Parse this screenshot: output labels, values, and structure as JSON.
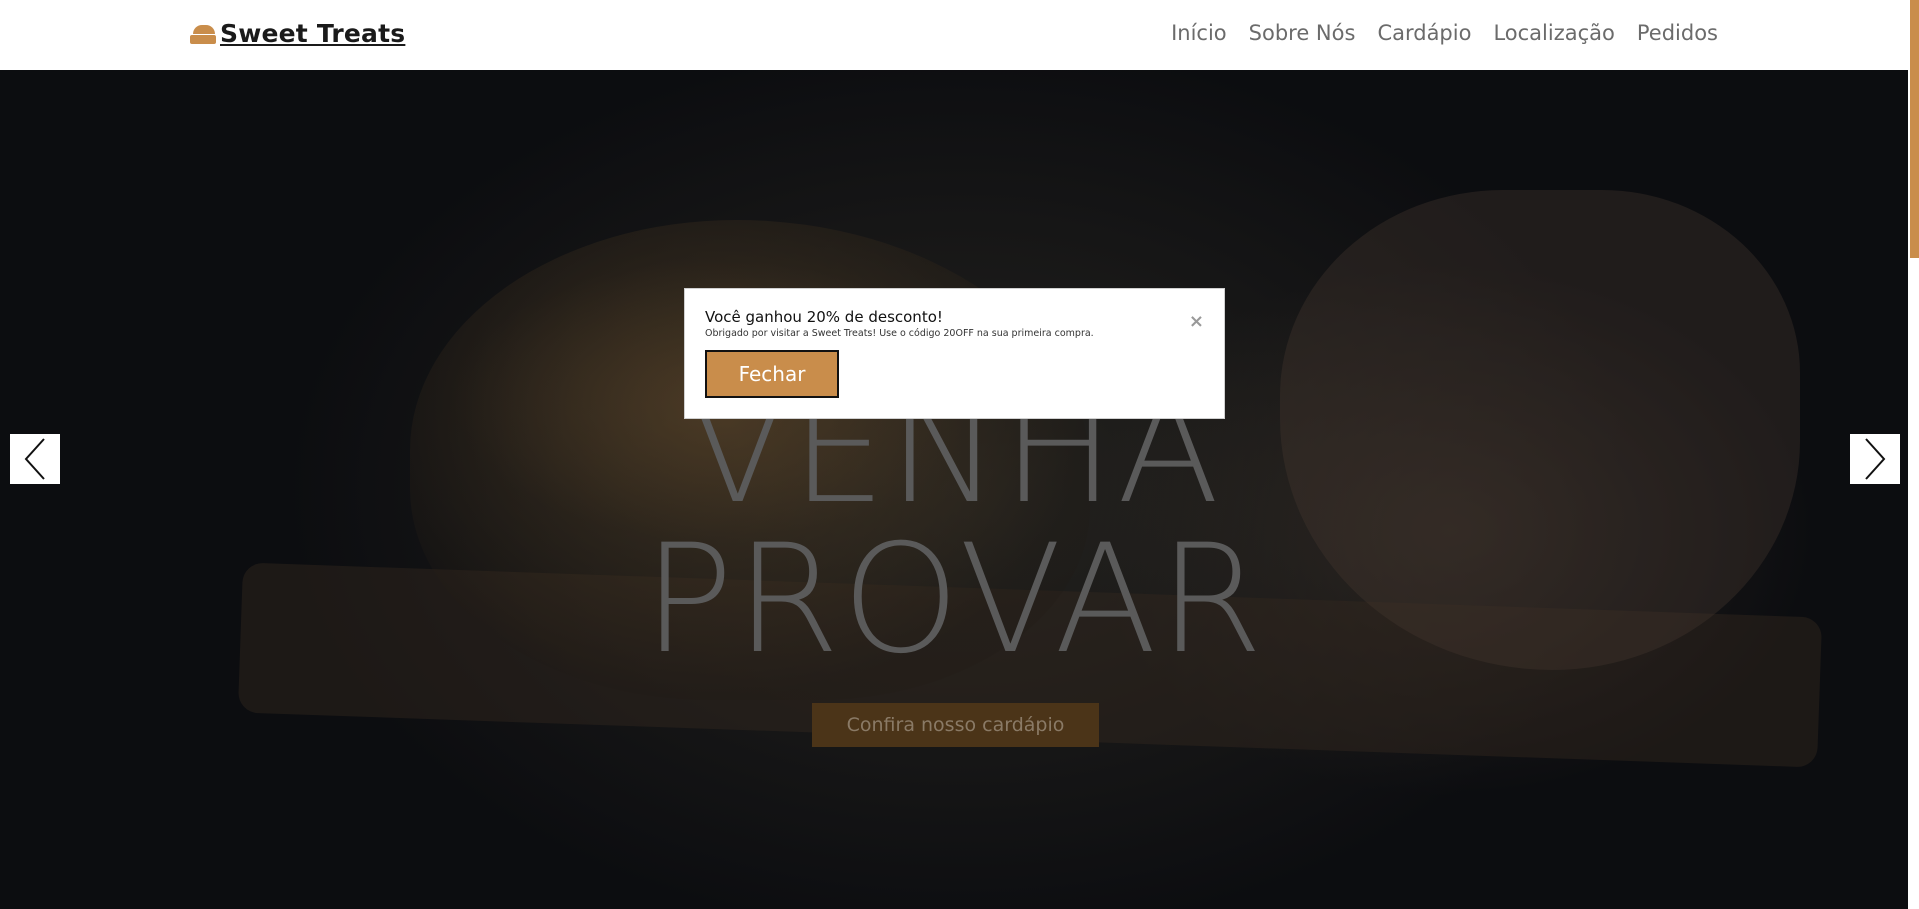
{
  "header": {
    "brand_icon": "cake-slice-icon",
    "brand_name": "Sweet Treats",
    "nav": [
      {
        "label": "Início"
      },
      {
        "label": "Sobre Nós"
      },
      {
        "label": "Cardápio"
      },
      {
        "label": "Localização"
      },
      {
        "label": "Pedidos"
      }
    ]
  },
  "hero": {
    "title_line1": "VENHA",
    "title_line2": "PROVAR",
    "cta_label": "Confira nosso cardápio",
    "prev_icon": "chevron-left-icon",
    "next_icon": "chevron-right-icon"
  },
  "modal": {
    "title": "Você ganhou 20% de desconto!",
    "message": "Obrigado por visitar a Sweet Treats! Use o código 20OFF na sua primeira compra.",
    "close_symbol": "×",
    "button_label": "Fechar"
  },
  "colors": {
    "accent": "#c98d4b",
    "header_bg": "#ffffff",
    "hero_bg": "#0d0f12",
    "cta_bg": "#4b3418"
  }
}
